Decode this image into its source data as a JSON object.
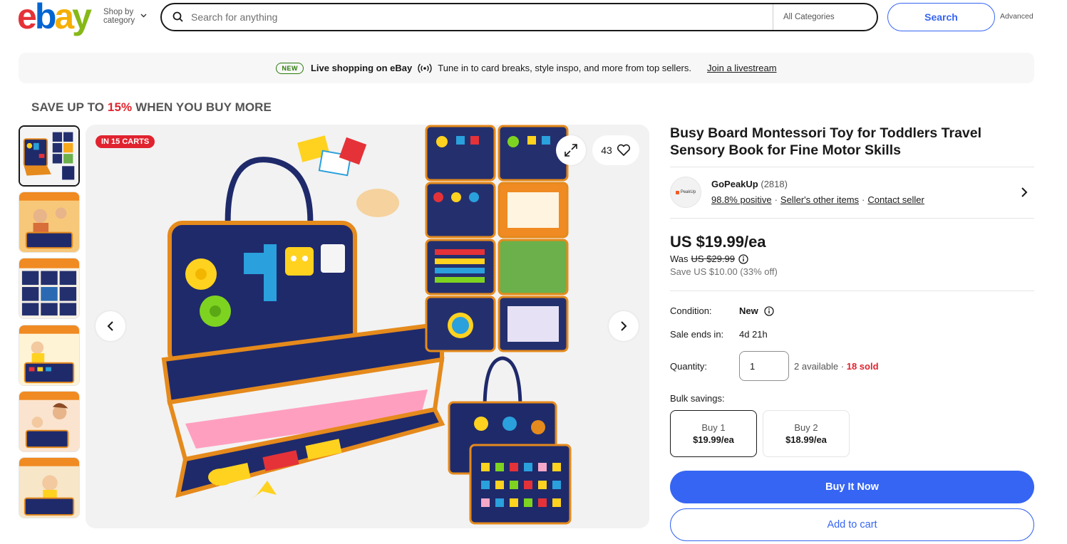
{
  "header": {
    "logo_letters": [
      "e",
      "b",
      "a",
      "y"
    ],
    "shop_by_line1": "Shop by",
    "shop_by_line2": "category",
    "search_placeholder": "Search for anything",
    "category_select": "All Categories",
    "search_button": "Search",
    "advanced": "Advanced"
  },
  "banner": {
    "badge": "NEW",
    "headline": "Live shopping on eBay",
    "tagline": "Tune in to card breaks, style inspo, and more from top sellers.",
    "link": "Join a livestream"
  },
  "promo": {
    "prefix": "SAVE UP TO ",
    "percent": "15%",
    "suffix": " WHEN YOU BUY MORE"
  },
  "gallery": {
    "carts_badge": "IN 15 CARTS",
    "watch_count": "43",
    "thumb_count": 6,
    "active_thumb": 1
  },
  "product": {
    "title": "Busy Board Montessori Toy for Toddlers Travel Sensory Book for Fine Motor Skills"
  },
  "seller": {
    "name": "GoPeakUp",
    "feedback_count": "(2818)",
    "avatar_text": "PeakUp",
    "positive": "98.8% positive",
    "other_items": "Seller's other items",
    "contact": "Contact seller"
  },
  "pricing": {
    "price": "US $19.99/ea",
    "was_label": "Was",
    "was_price": "US $29.99",
    "save": "Save US $10.00 (33% off)"
  },
  "details": {
    "condition_label": "Condition:",
    "condition_value": "New",
    "sale_ends_label": "Sale ends in:",
    "sale_ends_value": "4d 21h",
    "quantity_label": "Quantity:",
    "quantity_value": "1",
    "available": "2 available",
    "sold": "18 sold",
    "bulk_label": "Bulk savings:"
  },
  "bulk_options": [
    {
      "label": "Buy 1",
      "price": "$19.99/ea"
    },
    {
      "label": "Buy 2",
      "price": "$18.99/ea"
    }
  ],
  "actions": {
    "buy_now": "Buy It Now",
    "add_to_cart": "Add to cart"
  },
  "colors": {
    "ebay_red": "#e53238",
    "ebay_blue": "#0064d2",
    "ebay_yellow": "#f5af02",
    "ebay_green": "#86b817",
    "primary_blue": "#3665f3",
    "badge_red": "#e0232e",
    "new_green": "#2b7a0b"
  }
}
